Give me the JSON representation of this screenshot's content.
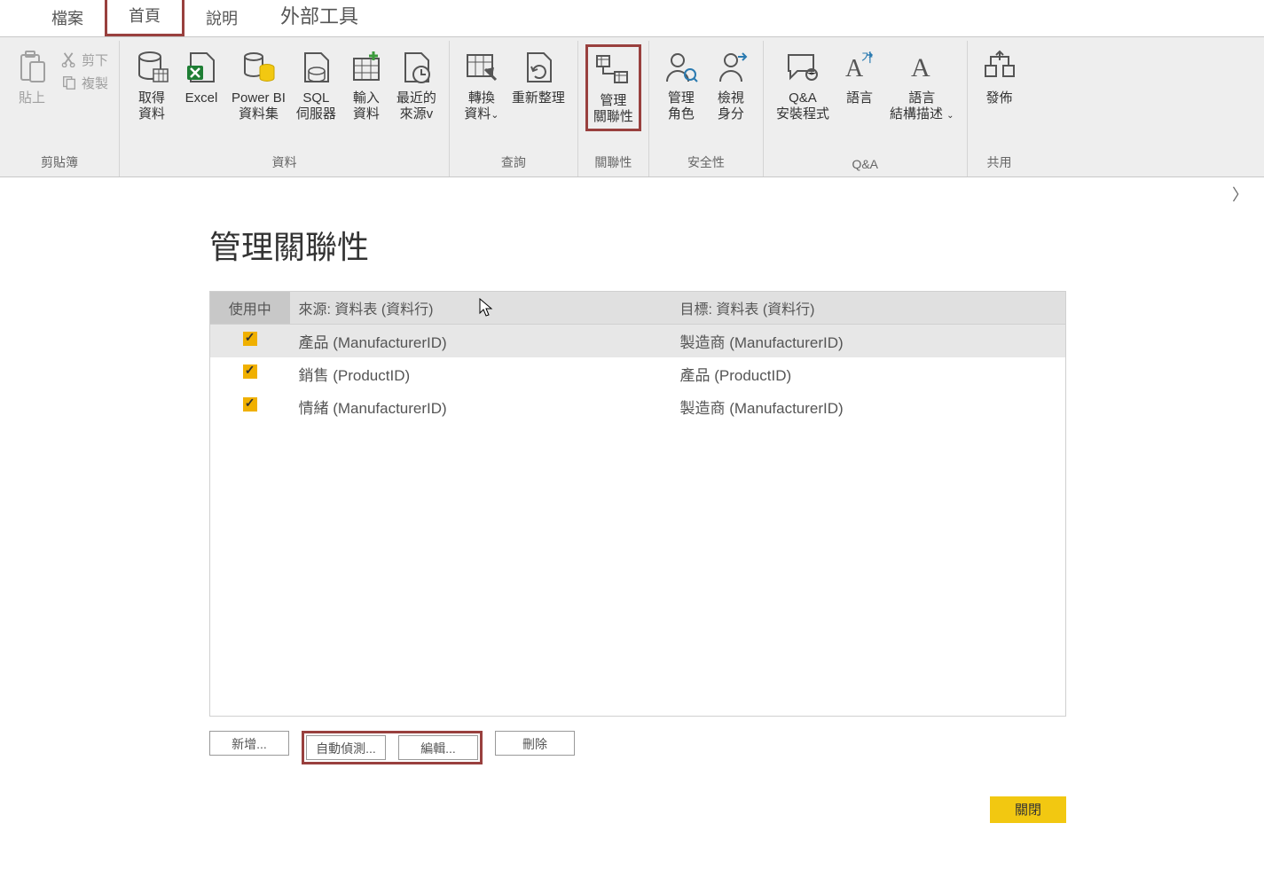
{
  "menu": {
    "file": "檔案",
    "home": "首頁",
    "help": "說明",
    "external": "外部工具"
  },
  "ribbon": {
    "clipboard": {
      "group": "剪貼簿",
      "paste": "貼上",
      "cut": "剪下",
      "copy": "複製"
    },
    "data": {
      "group": "資料",
      "getdata": "取得\n資料",
      "excel": "Excel",
      "powerbi": "Power BI\n資料集",
      "sql": "SQL\n伺服器",
      "enter": "輸入\n資料",
      "recent": "最近的\n來源v"
    },
    "query": {
      "group": "查詢",
      "transform": "轉換\n資料",
      "refresh": "重新整理"
    },
    "rel": {
      "group": "關聯性",
      "manage": "管理\n關聯性"
    },
    "sec": {
      "group": "安全性",
      "manage": "管理\n角色",
      "view": "檢視\n身分"
    },
    "qa": {
      "group": "Q&A",
      "qasetup": "Q&A\n安裝程式",
      "lang": "語言",
      "lang2": "語言\n結構描述"
    },
    "share": {
      "group": "共用",
      "publish": "發佈"
    }
  },
  "dialog": {
    "title": "管理關聯性",
    "headers": {
      "active": "使用中",
      "source": "來源: 資料表 (資料行)",
      "target": "目標: 資料表 (資料行)"
    },
    "rows": [
      {
        "checked": true,
        "source": "產品 (ManufacturerID)",
        "target": "製造商 (ManufacturerID)",
        "selected": true
      },
      {
        "checked": true,
        "source": "銷售 (ProductID)",
        "target": "產品 (ProductID)",
        "selected": false
      },
      {
        "checked": true,
        "source": "情緒 (ManufacturerID)",
        "target": "製造商 (ManufacturerID)",
        "selected": false
      }
    ],
    "buttons": {
      "new": "新增...",
      "autodetect": "自動偵測...",
      "edit": "編輯...",
      "delete": "刪除"
    },
    "close": "關閉"
  }
}
